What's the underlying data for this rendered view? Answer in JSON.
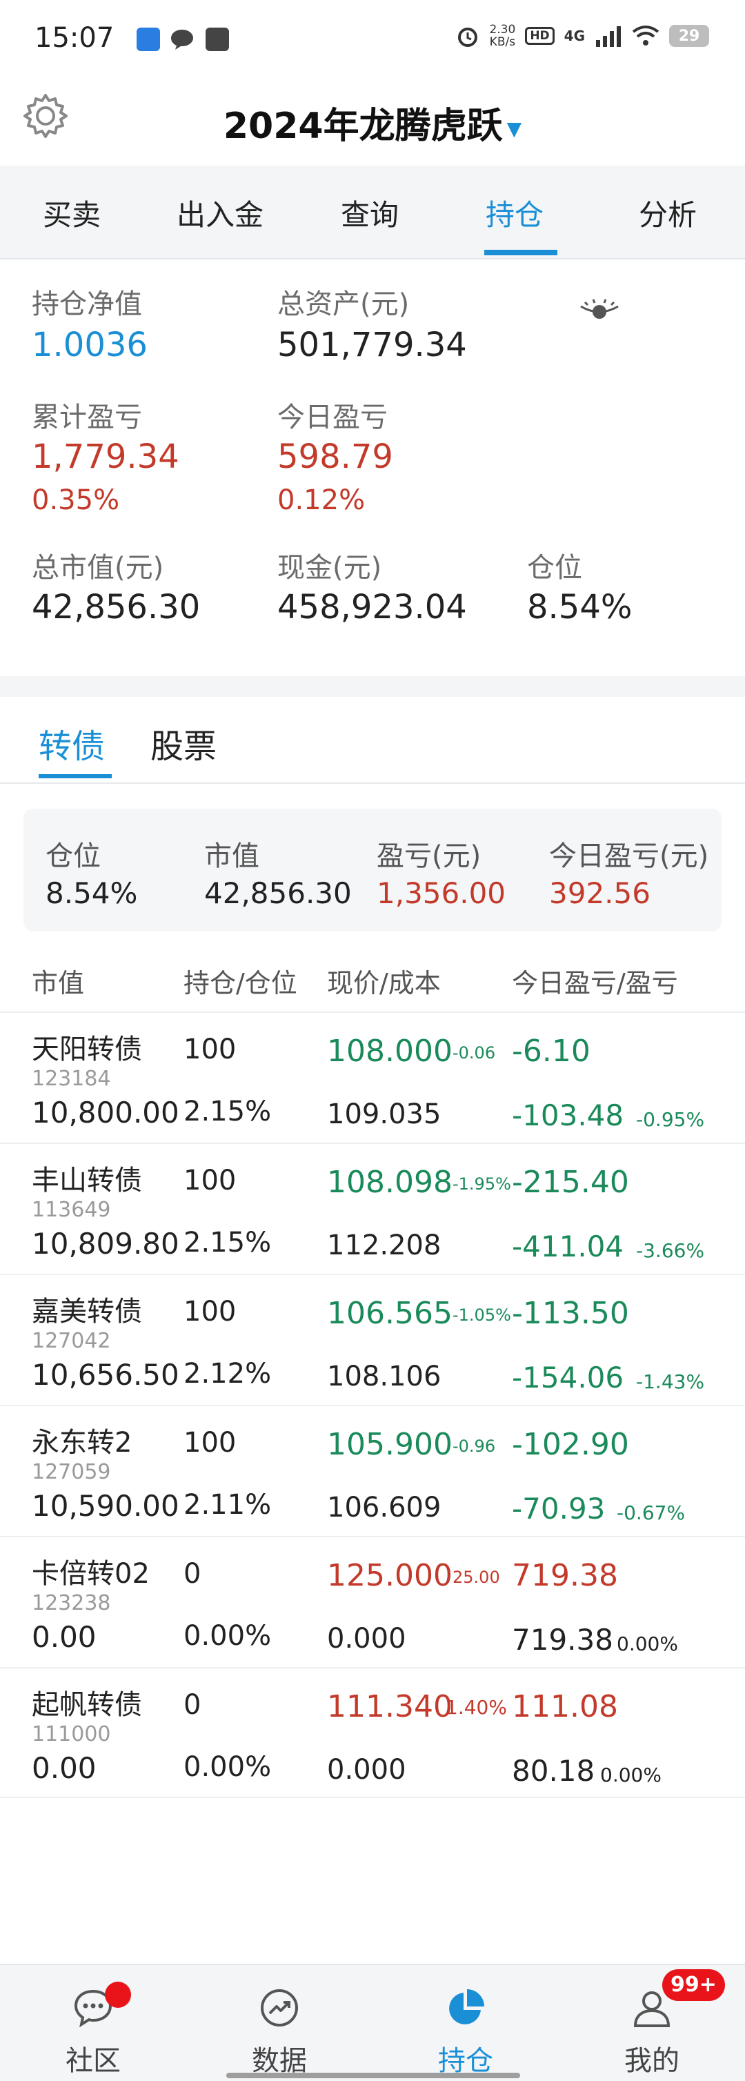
{
  "status_bar": {
    "time": "15:07",
    "speed_value": "2.30",
    "speed_unit": "KB/s",
    "hd": "HD",
    "network": "4G",
    "battery": "29"
  },
  "header": {
    "title": "2024年龙腾虎跃",
    "caret": "▼"
  },
  "tabs": [
    {
      "label": "买卖"
    },
    {
      "label": "出入金"
    },
    {
      "label": "查询"
    },
    {
      "label": "持仓"
    },
    {
      "label": "分析"
    }
  ],
  "summary": {
    "nav_label": "持仓净值",
    "nav_value": "1.0036",
    "total_assets_label": "总资产(元)",
    "total_assets_value": "501,779.34",
    "cum_pl_label": "累计盈亏",
    "cum_pl_value": "1,779.34",
    "cum_pl_pct": "0.35%",
    "today_pl_label": "今日盈亏",
    "today_pl_value": "598.79",
    "today_pl_pct": "0.12%",
    "market_value_label": "总市值(元)",
    "market_value_value": "42,856.30",
    "cash_label": "现金(元)",
    "cash_value": "458,923.04",
    "position_label": "仓位",
    "position_value": "8.54%"
  },
  "sub_tabs": [
    {
      "label": "转债"
    },
    {
      "label": "股票"
    }
  ],
  "card": {
    "position_label": "仓位",
    "position_value": "8.54%",
    "market_value_label": "市值",
    "market_value_value": "42,856.30",
    "pl_label": "盈亏(元)",
    "pl_value": "1,356.00",
    "today_pl_label": "今日盈亏(元)",
    "today_pl_value": "392.56"
  },
  "table": {
    "headers": [
      "市值",
      "持仓/仓位",
      "现价/成本",
      "今日盈亏/盈亏"
    ],
    "rows": [
      {
        "name": "天阳转债",
        "code": "123184",
        "market_value": "10,800.00",
        "qty": "100",
        "ratio": "2.15%",
        "price": "108.000",
        "change": "-0.06",
        "cost": "109.035",
        "today_pl": "-6.10",
        "pl": "-103.48",
        "pl_pct": "-0.95%"
      },
      {
        "name": "丰山转债",
        "code": "113649",
        "market_value": "10,809.80",
        "qty": "100",
        "ratio": "2.15%",
        "price": "108.098",
        "change": "-1.95%",
        "cost": "112.208",
        "today_pl": "-215.40",
        "pl": "-411.04",
        "pl_pct": "-3.66%"
      },
      {
        "name": "嘉美转债",
        "code": "127042",
        "market_value": "10,656.50",
        "qty": "100",
        "ratio": "2.12%",
        "price": "106.565",
        "change": "-1.05%",
        "cost": "108.106",
        "today_pl": "-113.50",
        "pl": "-154.06",
        "pl_pct": "-1.43%"
      },
      {
        "name": "永东转2",
        "code": "127059",
        "market_value": "10,590.00",
        "qty": "100",
        "ratio": "2.11%",
        "price": "105.900",
        "change": "-0.96",
        "cost": "106.609",
        "today_pl": "-102.90",
        "pl": "-70.93",
        "pl_pct": "-0.67%"
      },
      {
        "name": "卡倍转02",
        "code": "123238",
        "market_value": "0.00",
        "qty": "0",
        "ratio": "0.00%",
        "price": "125.000",
        "change": "25.00",
        "cost": "0.000",
        "today_pl": "719.38",
        "pl": "719.38",
        "pl_pct": "0.00%"
      },
      {
        "name": "起帆转债",
        "code": "111000",
        "market_value": "0.00",
        "qty": "0",
        "ratio": "0.00%",
        "price": "111.340",
        "change": "1.40%",
        "cost": "0.000",
        "today_pl": "111.08",
        "pl": "80.18",
        "pl_pct": "0.00%"
      }
    ]
  },
  "bottom_nav": [
    {
      "label": "社区"
    },
    {
      "label": "数据"
    },
    {
      "label": "持仓"
    },
    {
      "label": "我的"
    }
  ],
  "badge_count": "99+",
  "colors": {
    "accent": "#1a8fd6",
    "up": "#c33a2b",
    "down": "#1b8a5a"
  }
}
